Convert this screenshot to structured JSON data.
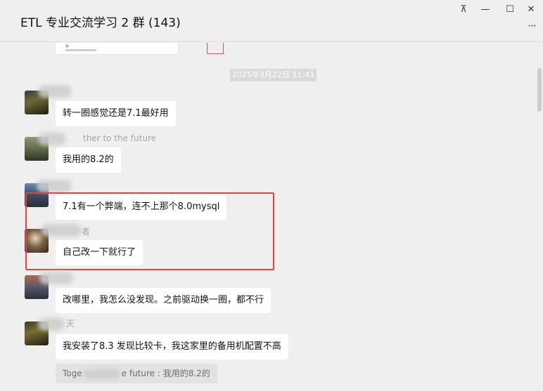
{
  "window": {
    "title": "ETL 专业交流学习 2 群 (143)",
    "buttons": {
      "pin": "⊼",
      "minimize": "—",
      "maximize": "☐",
      "close": "✕",
      "more": "···"
    }
  },
  "timestamp": "2025年3月22日 11:41",
  "messages": [
    {
      "avatar": "avatar-1",
      "sender": "",
      "text": "转一圈感觉还是7.1最好用"
    },
    {
      "avatar": "avatar-2",
      "sender": "ther to the future",
      "text": "我用的8.2的"
    },
    {
      "avatar": "avatar-3",
      "sender": "",
      "text": "7.1有一个弊端，连不上那个8.0mysql"
    },
    {
      "avatar": "avatar-4",
      "sender": "者",
      "text": "自己改一下就行了"
    },
    {
      "avatar": "avatar-5",
      "sender": "",
      "text": "改哪里，我怎么没发现。之前驱动换一圈，都不行"
    },
    {
      "avatar": "avatar-6",
      "sender": "天",
      "text": "我安装了8.3  发现比较卡，我这家里的备用机配置不高"
    }
  ],
  "quote": {
    "prefix": "Toge",
    "suffix": "e future : 我用的8.2的"
  },
  "colors": {
    "highlight": "#e0443e",
    "bubble": "#ffffff",
    "background": "#efefef"
  }
}
